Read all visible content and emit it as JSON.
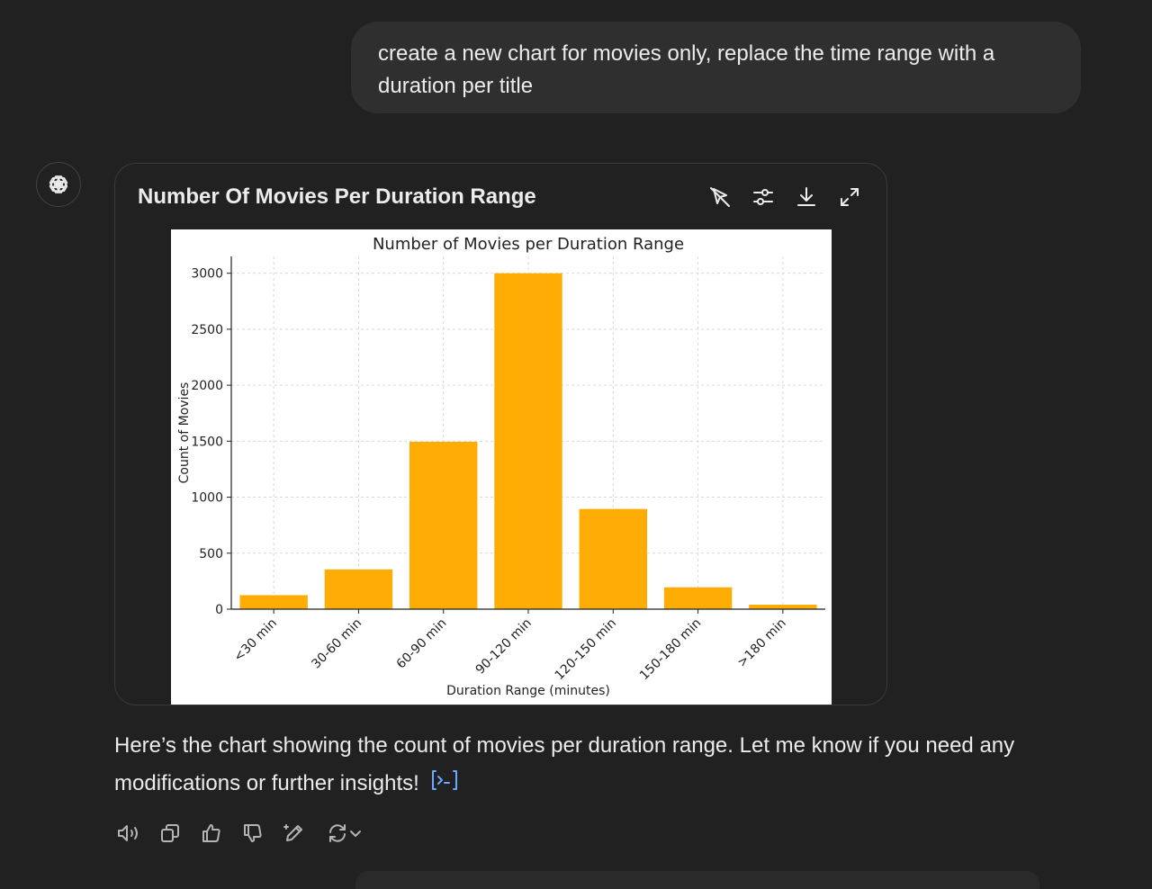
{
  "user_message": {
    "text": "create a new chart for movies only, replace the time range with a duration per title"
  },
  "assistant": {
    "card_title": "Number Of Movies Per Duration Range",
    "reply_text": "Here’s the chart showing the count of movies per duration range. Let me know if you need any modifications or further insights!",
    "toolbar_icons": [
      "interactive-chart-toggle-icon",
      "chart-settings-icon",
      "download-icon",
      "expand-icon"
    ],
    "action_icons": [
      "read-aloud-icon",
      "copy-icon",
      "thumbs-up-icon",
      "thumbs-down-icon",
      "edit-canvas-icon",
      "regenerate-icon"
    ]
  },
  "chart_data": {
    "type": "bar",
    "title": "Number of Movies per Duration Range",
    "xlabel": "Duration Range (minutes)",
    "ylabel": "Count of Movies",
    "categories": [
      "<30 min",
      "30-60 min",
      "60-90 min",
      "90-120 min",
      "120-150 min",
      "150-180 min",
      ">180 min"
    ],
    "values": [
      125,
      355,
      1495,
      3000,
      895,
      195,
      40
    ],
    "yticks": [
      0,
      500,
      1000,
      1500,
      2000,
      2500,
      3000
    ],
    "ylim": [
      0,
      3150
    ],
    "grid": true,
    "bar_color": "#ffad05",
    "legend": "none"
  }
}
